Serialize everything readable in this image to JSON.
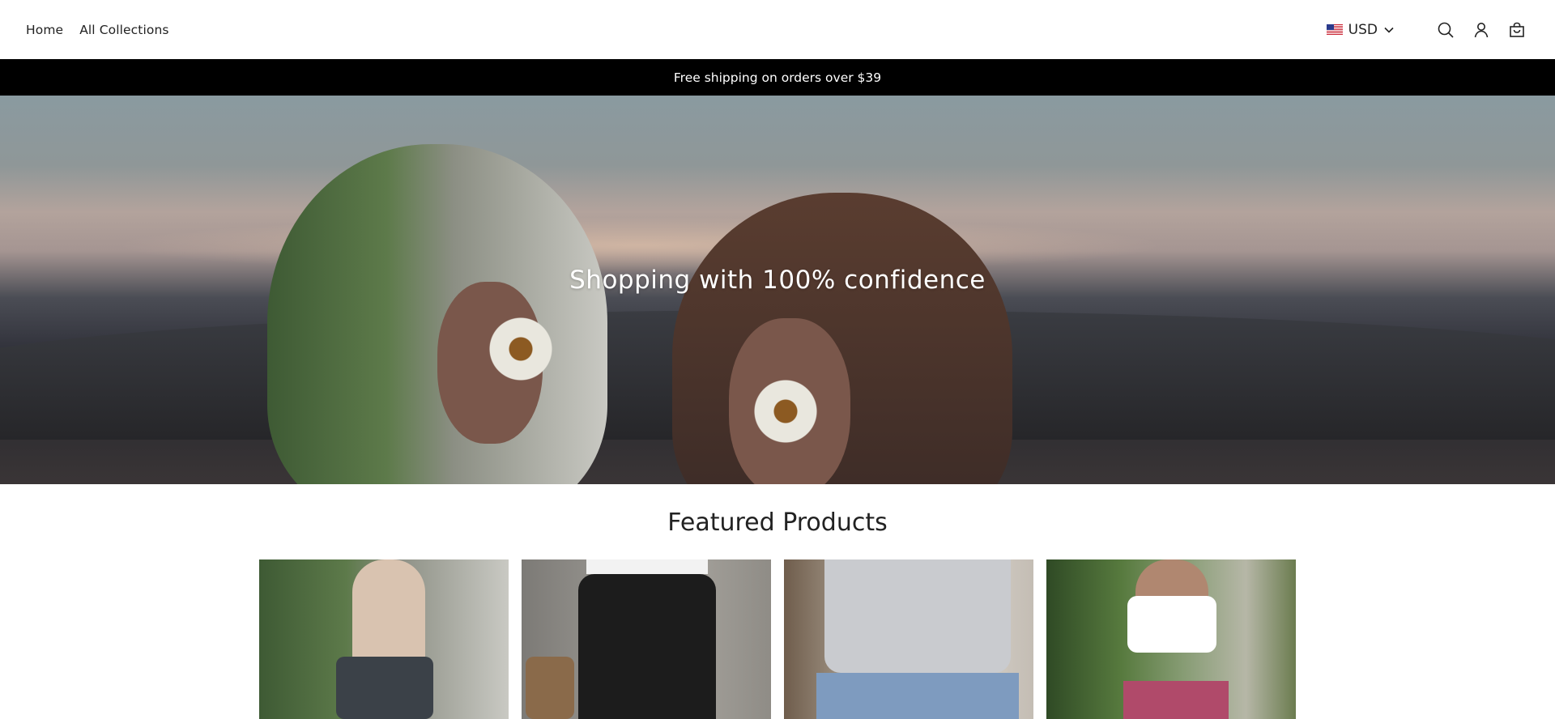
{
  "header": {
    "nav": [
      "Home",
      "All Collections"
    ],
    "currency": "USD"
  },
  "announcement": "Free shipping on orders over $39",
  "hero": {
    "title": "Shopping with 100% confidence"
  },
  "featured": {
    "title": "Featured Products",
    "products": [
      {
        "image": "woman-beige-bodysuit-dark-skirt"
      },
      {
        "image": "black-high-waist-pants"
      },
      {
        "image": "grey-tank-denim-shorts"
      },
      {
        "image": "white-crop-top-floral-skirt"
      }
    ]
  },
  "icons": {
    "search": "search-icon",
    "account": "account-icon",
    "cart": "cart-icon",
    "chevron": "chevron-down-icon",
    "flag": "us-flag-icon"
  },
  "colors": {
    "announcement_bg": "#000000",
    "text": "#222222"
  }
}
